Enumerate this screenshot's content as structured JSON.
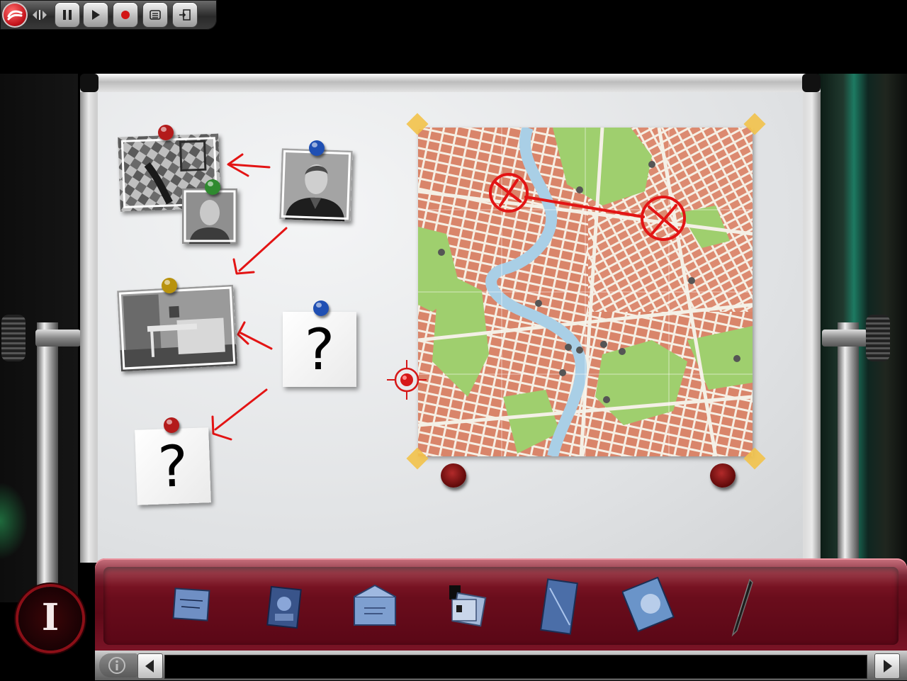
{
  "toolbar": {
    "buttons": [
      {
        "name": "pause-button",
        "icon": "pause-icon"
      },
      {
        "name": "play-button",
        "icon": "play-icon"
      },
      {
        "name": "record-button",
        "icon": "record-icon"
      },
      {
        "name": "menu-button",
        "icon": "list-icon"
      },
      {
        "name": "exit-button",
        "icon": "exit-icon"
      }
    ]
  },
  "board": {
    "unknown_suspect_label": "?",
    "unknown_location_label": "?",
    "pin_colors": {
      "red": "#b31b1b",
      "blue": "#1f4fb3",
      "green": "#2f8a2f",
      "yellow": "#b8920e"
    }
  },
  "inventory": {
    "items": [
      {
        "name": "business-card"
      },
      {
        "name": "blue-photo"
      },
      {
        "name": "envelope"
      },
      {
        "name": "documents"
      },
      {
        "name": "plastic-sleeve"
      },
      {
        "name": "photo-bag"
      },
      {
        "name": "pen"
      }
    ]
  },
  "investigation_button_label": "I",
  "colors": {
    "inventory_red": "#6d0f1f",
    "marker_red": "#e31414",
    "map_street": "#d9856a",
    "map_park": "#9fcf6e",
    "map_river": "#a9cfe6"
  }
}
